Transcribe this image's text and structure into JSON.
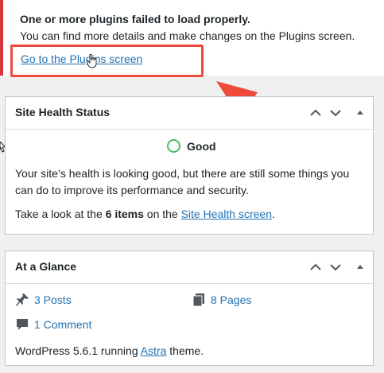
{
  "notice": {
    "title": "One or more plugins failed to load properly.",
    "description": "You can find more details and make changes on the Plugins screen.",
    "link_label": "Go to the Plugins screen"
  },
  "site_health": {
    "title": "Site Health Status",
    "status_label": "Good",
    "message": "Your site’s health is looking good, but there are still some things you can do to improve its performance and security.",
    "cta_prefix": "Take a look at the ",
    "cta_count": "6 items",
    "cta_middle": " on the ",
    "cta_link": "Site Health screen",
    "cta_suffix": "."
  },
  "at_a_glance": {
    "title": "At a Glance",
    "posts": "3 Posts",
    "pages": "8 Pages",
    "comments": "1 Comment",
    "wp_prefix": "WordPress 5.6.1 running ",
    "theme_link": "Astra",
    "wp_suffix": " theme."
  },
  "icons": {
    "move_up": "chevron-up-icon",
    "move_down": "chevron-down-icon",
    "toggle": "caret-up-icon",
    "posts": "pushpin-icon",
    "pages": "pages-icon",
    "comments": "comment-icon"
  },
  "colors": {
    "notice_border": "#d63638",
    "link": "#2271b1",
    "good": "#4ab866",
    "annotation": "#ee4b3c"
  }
}
